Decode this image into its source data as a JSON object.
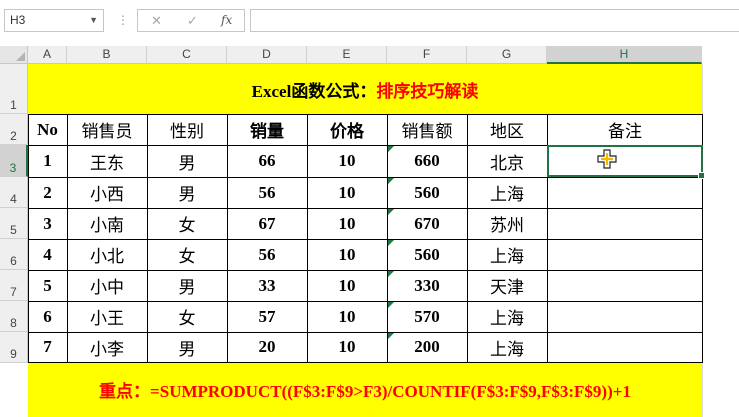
{
  "formula_bar": {
    "name_box": "H3",
    "separator": "⋮",
    "cancel_icon": "✕",
    "enter_icon": "✓",
    "function_icon": "fx",
    "formula": ""
  },
  "grid": {
    "columns": [
      "A",
      "B",
      "C",
      "D",
      "E",
      "F",
      "G",
      "H"
    ],
    "rows": [
      "1",
      "2",
      "3",
      "4",
      "5",
      "6",
      "7",
      "8",
      "9"
    ],
    "selected_cell": "H3",
    "selected_column": "H",
    "selected_row": "3"
  },
  "title": {
    "black_part": "Excel函数公式：",
    "red_part": "排序技巧解读"
  },
  "table": {
    "headers": [
      "No",
      "销售员",
      "性别",
      "销量",
      "价格",
      "销售额",
      "地区",
      "备注"
    ],
    "rows": [
      [
        "1",
        "王东",
        "男",
        "66",
        "10",
        "660",
        "北京",
        ""
      ],
      [
        "2",
        "小西",
        "男",
        "56",
        "10",
        "560",
        "上海",
        ""
      ],
      [
        "3",
        "小南",
        "女",
        "67",
        "10",
        "670",
        "苏州",
        ""
      ],
      [
        "4",
        "小北",
        "女",
        "56",
        "10",
        "560",
        "上海",
        ""
      ],
      [
        "5",
        "小中",
        "男",
        "33",
        "10",
        "330",
        "天津",
        ""
      ],
      [
        "6",
        "小王",
        "女",
        "57",
        "10",
        "570",
        "上海",
        ""
      ],
      [
        "7",
        "小李",
        "男",
        "20",
        "10",
        "200",
        "上海",
        ""
      ]
    ]
  },
  "footer": {
    "text": "重点：=SUMPRODUCT((F$3:F$9>F3)/COUNTIF(F$3:F$9,F$3:F$9))+1"
  },
  "colors": {
    "highlight": "#ffff00",
    "accent_red": "#ff0000",
    "selection_green": "#217346",
    "error_indicator": "#1e7b45"
  }
}
